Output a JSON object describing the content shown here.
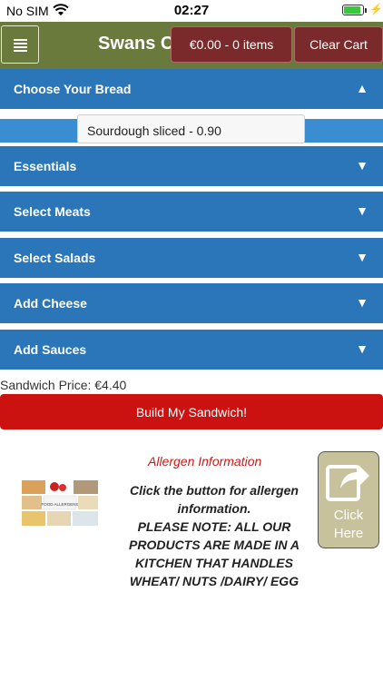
{
  "status_bar": {
    "carrier": "No SIM",
    "time": "02:27"
  },
  "header": {
    "title": "Swans C",
    "cart_label": "€0.00 - 0 items",
    "clear_cart_label": "Clear Cart",
    "colors": {
      "header_bg": "#6a7a3d",
      "cart_bg": "#7a2a2a"
    }
  },
  "accordion": {
    "sections": [
      {
        "label": "Choose Your Bread",
        "expanded": true,
        "arrow": "▲"
      },
      {
        "label": "Essentials",
        "expanded": false,
        "arrow": "▼"
      },
      {
        "label": "Select Meats",
        "expanded": false,
        "arrow": "▼"
      },
      {
        "label": "Select Salads",
        "expanded": false,
        "arrow": "▼"
      },
      {
        "label": "Add Cheese",
        "expanded": false,
        "arrow": "▼"
      },
      {
        "label": "Add Sauces",
        "expanded": false,
        "arrow": "▼"
      }
    ],
    "bread_selected": "Sourdough sliced - 0.90",
    "color": "#2a76b8"
  },
  "sandwich_price": "Sandwich Price: €4.40",
  "build_button": "Build My Sandwich!",
  "allergen": {
    "title": "Allergen Information",
    "image_caption": "FOOD ALLERGENS",
    "lines": [
      "Click the button for allergen",
      "information.",
      "PLEASE NOTE: ALL OUR",
      "PRODUCTS ARE MADE IN A",
      "KITCHEN THAT HANDLES",
      "WHEAT/ NUTS /DAIRY/ EGG"
    ],
    "click_line1": "Click",
    "click_line2": "Here"
  }
}
